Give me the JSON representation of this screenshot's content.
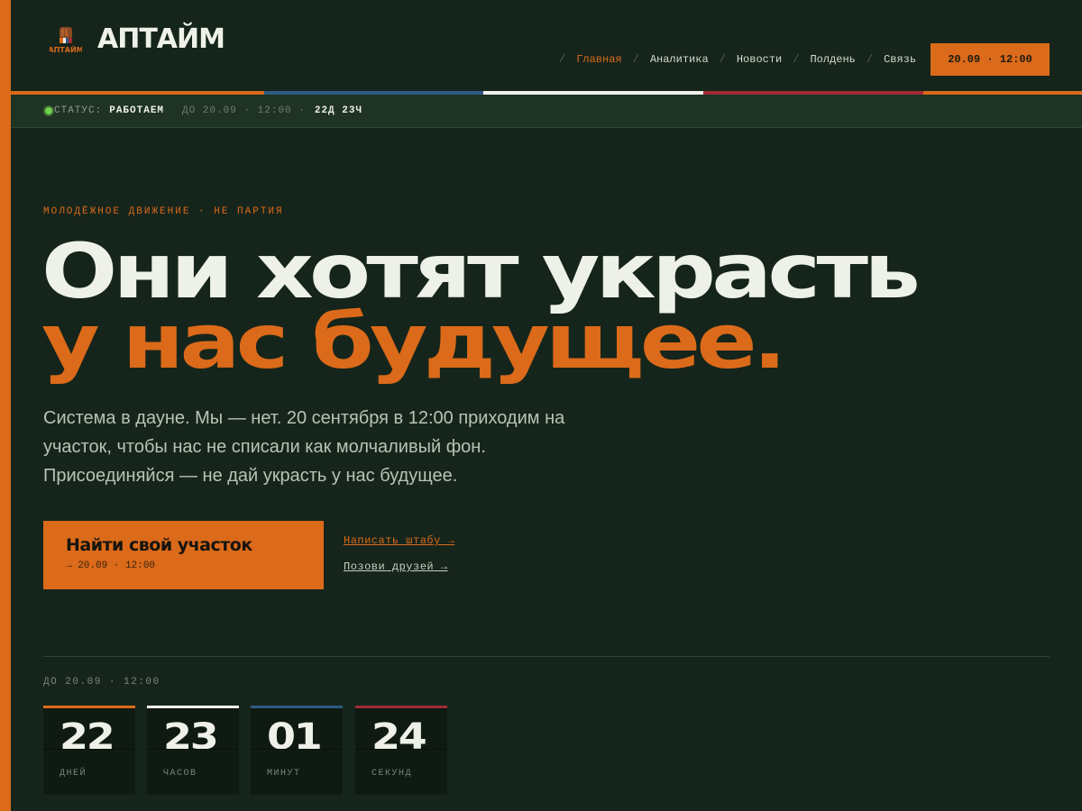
{
  "brand": {
    "name": "АПТАЙМ",
    "logo_caption": "АПТАЙМ"
  },
  "colors": {
    "accent": "#db6a1a",
    "background": "#16251b",
    "blue": "#2e5b85",
    "white": "#f1f1ec",
    "red": "#a22a35"
  },
  "nav": {
    "items": [
      {
        "label": "Главная",
        "active": true
      },
      {
        "label": "Аналитика",
        "active": false
      },
      {
        "label": "Новости",
        "active": false
      },
      {
        "label": "Полдень",
        "active": false
      },
      {
        "label": "Связь",
        "active": false
      }
    ],
    "date_button": "20.09 · 12:00"
  },
  "status": {
    "label": "СТАТУС:",
    "value": "РАБОТАЕМ",
    "until": "ДО 20.09 · 12:00 ·",
    "countdown": "22Д 23Ч"
  },
  "hero": {
    "eyebrow": "МОЛОДЁЖНОЕ ДВИЖЕНИЕ · НЕ ПАРТИЯ",
    "headline_line1": "Они хотят украсть",
    "headline_line2": "у нас будущее.",
    "lead": "Система в дауне. Мы — нет. 20 сентября в 12:00 приходим на участок, чтобы нас не списали как молчаливый фон. Присоединяйся — не дай украсть у нас будущее.",
    "cta_title": "Найти свой участок",
    "cta_sub": "→ 20.09 · 12:00",
    "link_write": "Написать штабу →",
    "link_invite": "Позови друзей →"
  },
  "countdown": {
    "label": "ДО 20.09 · 12:00",
    "units": [
      {
        "value": "22",
        "unit": "ДНЕЙ",
        "color": "#db6a1a"
      },
      {
        "value": "23",
        "unit": "ЧАСОВ",
        "color": "#f1f1ec"
      },
      {
        "value": "01",
        "unit": "МИНУТ",
        "color": "#2e5b85"
      },
      {
        "value": "24",
        "unit": "СЕКУНД",
        "color": "#a22a35"
      }
    ]
  }
}
